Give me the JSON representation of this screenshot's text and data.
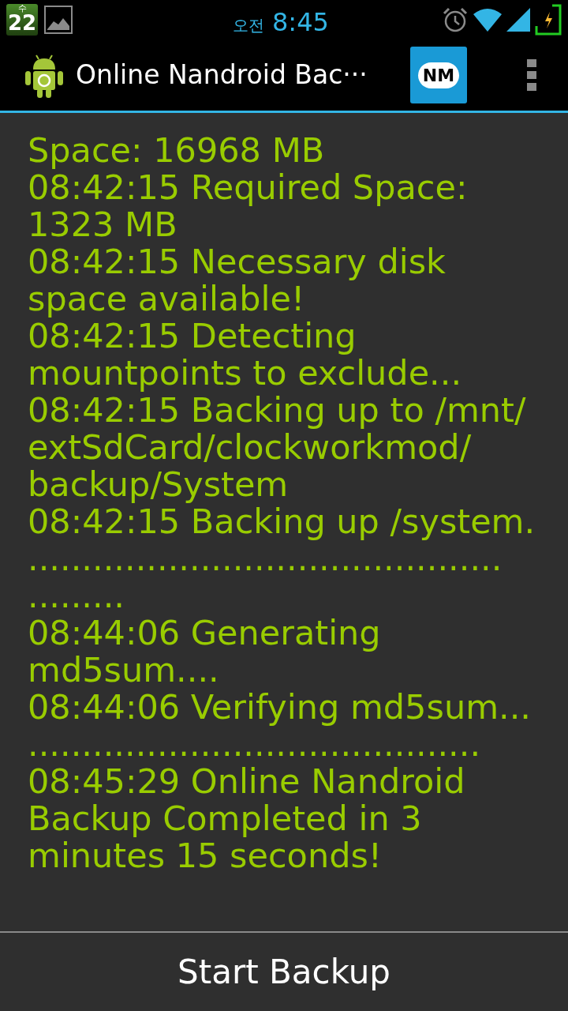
{
  "status_bar": {
    "calendar_weekday": "수",
    "calendar_day": "22",
    "ampm": "오전",
    "time": "8:45"
  },
  "action_bar": {
    "title": "Online Nandroid Bac···",
    "action_logo_text": "NM"
  },
  "log": {
    "lines": [
      "Space: 16968 MB",
      "08:42:15 Required Space:",
      "1323 MB",
      "08:42:15 Necessary disk",
      "space available!",
      "08:42:15 Detecting",
      "mountpoints to exclude...",
      "08:42:15 Backing up to /mnt/",
      "extSdCard/clockworkmod/",
      "backup/System",
      "08:42:15 Backing up /system.",
      "............................................",
      ".........",
      "08:44:06 Generating",
      "md5sum....",
      "08:44:06 Verifying md5sum...",
      "..........................................",
      "08:45:29 Online Nandroid",
      "Backup Completed in 3",
      "minutes 15 seconds!"
    ]
  },
  "button": {
    "label": "Start Backup"
  }
}
